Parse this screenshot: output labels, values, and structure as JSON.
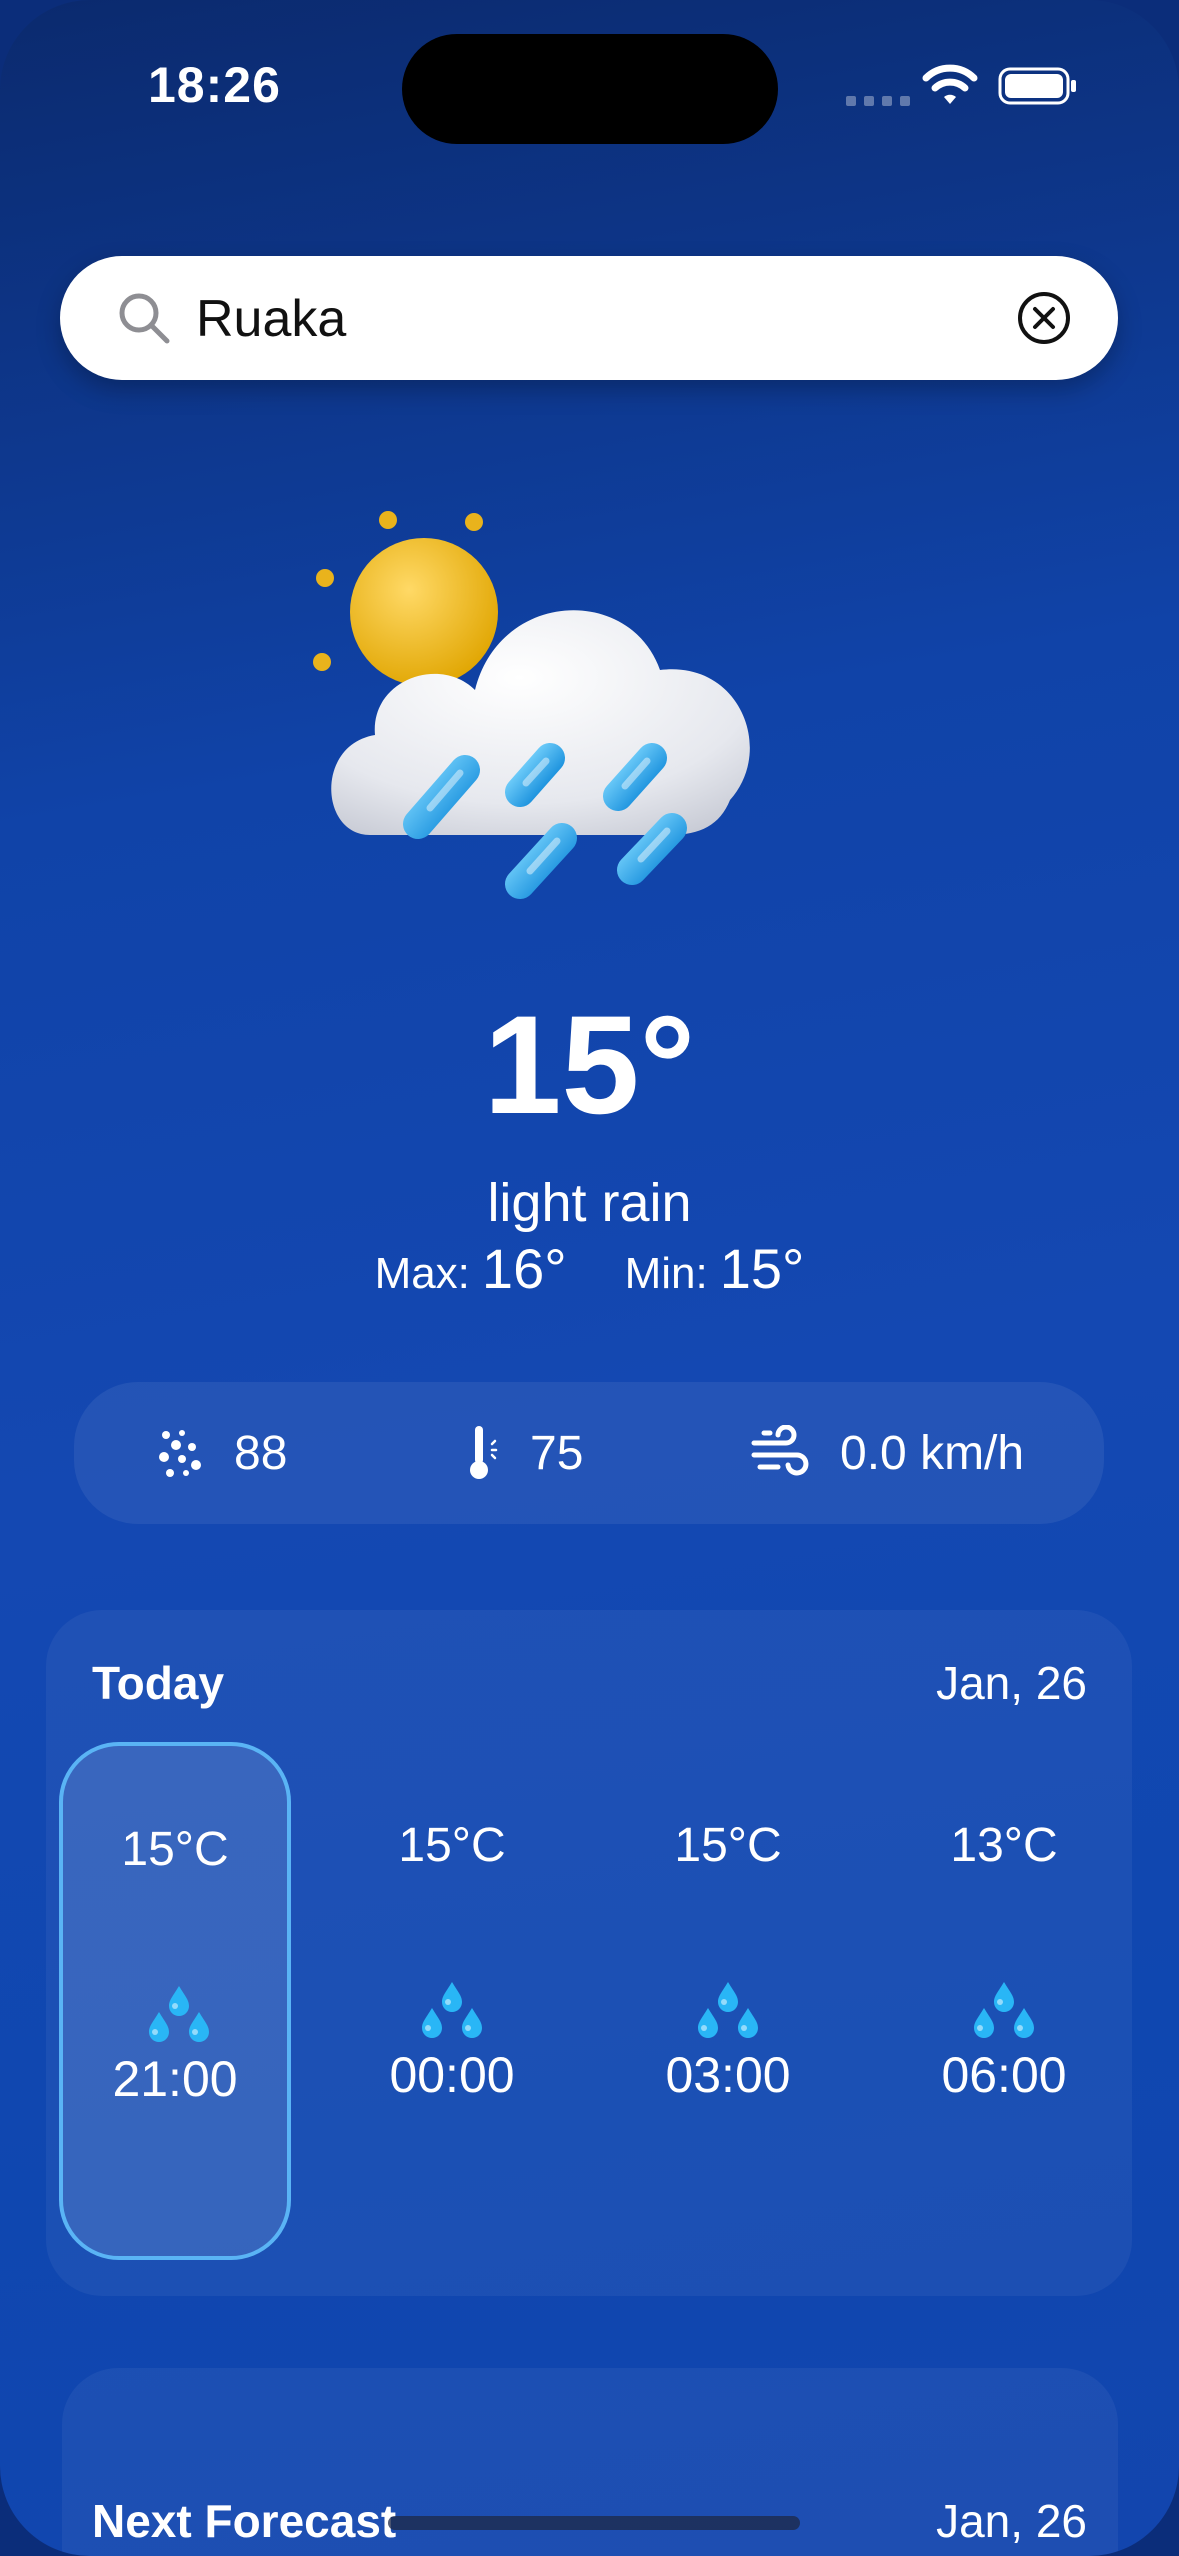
{
  "status_bar": {
    "time": "18:26"
  },
  "search": {
    "value": "Ruaka",
    "placeholder": ""
  },
  "current": {
    "temperature": "15°",
    "condition": "light rain",
    "max_label": "Max:",
    "max_value": "16°",
    "min_label": "Min:",
    "min_value": "15°",
    "icon": "sun-cloud-rain-icon"
  },
  "stats": {
    "humidity": "88",
    "humidity_icon": "humidity-dots-icon",
    "feels": "75",
    "feels_icon": "thermometer-icon",
    "wind": "0.0 km/h",
    "wind_icon": "wind-icon"
  },
  "today": {
    "title": "Today",
    "date": "Jan, 26",
    "hours": [
      {
        "temp": "15°C",
        "time": "21:00",
        "icon": "raindrops-icon",
        "selected": true
      },
      {
        "temp": "15°C",
        "time": "00:00",
        "icon": "raindrops-icon",
        "selected": false
      },
      {
        "temp": "15°C",
        "time": "03:00",
        "icon": "raindrops-icon",
        "selected": false
      },
      {
        "temp": "13°C",
        "time": "06:00",
        "icon": "raindrops-icon",
        "selected": false
      }
    ]
  },
  "next_forecast": {
    "title": "Next Forecast",
    "date": "Jan, 26"
  },
  "colors": {
    "accent": "#5ab4f5",
    "background": "#1448b2",
    "drop": "#29b6f6"
  }
}
